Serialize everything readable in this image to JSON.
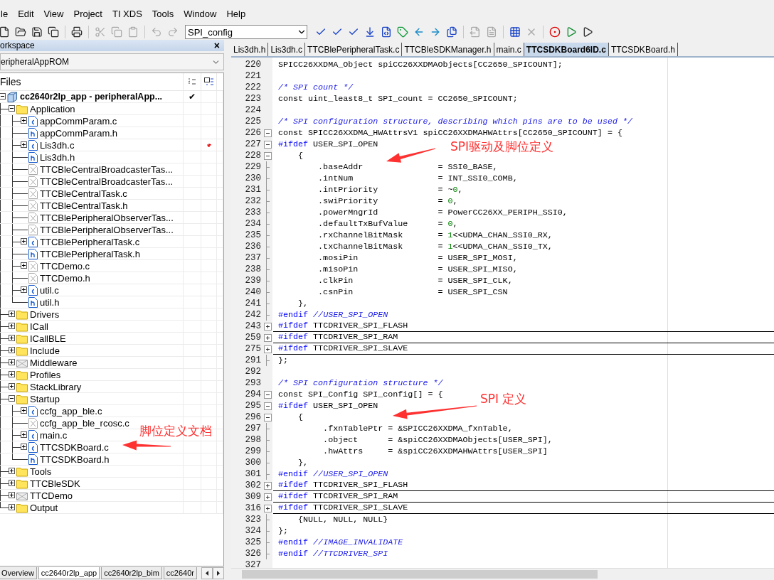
{
  "menu": [
    "le",
    "Edit",
    "View",
    "Project",
    "TI XDS",
    "Tools",
    "Window",
    "Help"
  ],
  "toolbar": {
    "buttons": [
      {
        "disabled": false
      },
      {
        "disabled": false
      },
      {
        "disabled": false
      },
      {
        "disabled": false
      },
      {
        "disabled": false
      },
      {
        "disabled": true
      },
      {
        "disabled": true
      },
      {
        "disabled": true
      },
      {
        "disabled": true
      },
      {
        "disabled": true
      }
    ],
    "combo": "SPI_config",
    "buttons_2": [
      {
        "disabled": false
      },
      {
        "disabled": false
      },
      {
        "disabled": false
      },
      {
        "disabled": false
      },
      {
        "disabled": false
      },
      {
        "disabled": false
      },
      {
        "disabled": false
      },
      {
        "disabled": false
      },
      {
        "disabled": false
      },
      {
        "disabled": true
      },
      {
        "disabled": true
      },
      {
        "disabled": false
      },
      {
        "disabled": true
      },
      {
        "disabled": false
      },
      {
        "disabled": false
      },
      {
        "disabled": false
      }
    ]
  },
  "workspace": {
    "title": "orkspace",
    "close": "×",
    "configuration": "eripheralAppROM",
    "tree": {
      "header": "Files",
      "root": {
        "label": "cc2640r2lp_app - peripheralApp...",
        "kind": "project",
        "expanded": true,
        "check": "✔",
        "children": [
          {
            "label": "Application",
            "kind": "folder",
            "expanded": true,
            "children": [
              {
                "label": "appCommParam.c",
                "kind": "c",
                "expanded": false
              },
              {
                "label": "appCommParam.h",
                "kind": "h"
              },
              {
                "label": "Lis3dh.c",
                "kind": "c",
                "expanded": false,
                "modified": true
              },
              {
                "label": "Lis3dh.h",
                "kind": "h"
              },
              {
                "label": "TTCBleCentralBroadcasterTas...",
                "kind": "excluded"
              },
              {
                "label": "TTCBleCentralBroadcasterTas...",
                "kind": "excluded"
              },
              {
                "label": "TTCBleCentralTask.c",
                "kind": "excluded"
              },
              {
                "label": "TTCBleCentralTask.h",
                "kind": "excluded"
              },
              {
                "label": "TTCBlePeripheralObserverTas...",
                "kind": "excluded"
              },
              {
                "label": "TTCBlePeripheralObserverTas...",
                "kind": "excluded"
              },
              {
                "label": "TTCBlePeripheralTask.c",
                "kind": "c",
                "expanded": false
              },
              {
                "label": "TTCBlePeripheralTask.h",
                "kind": "h"
              },
              {
                "label": "TTCDemo.c",
                "kind": "excluded",
                "expanded": false
              },
              {
                "label": "TTCDemo.h",
                "kind": "excluded"
              },
              {
                "label": "util.c",
                "kind": "c",
                "expanded": false
              },
              {
                "label": "util.h",
                "kind": "h"
              }
            ]
          },
          {
            "label": "Drivers",
            "kind": "folder",
            "expanded": false
          },
          {
            "label": "ICall",
            "kind": "folder",
            "expanded": false
          },
          {
            "label": "ICallBLE",
            "kind": "folder",
            "expanded": false
          },
          {
            "label": "Include",
            "kind": "folder",
            "expanded": false
          },
          {
            "label": "Middleware",
            "kind": "folder-excluded",
            "expanded": false
          },
          {
            "label": "Profiles",
            "kind": "folder",
            "expanded": false
          },
          {
            "label": "StackLibrary",
            "kind": "folder",
            "expanded": false
          },
          {
            "label": "Startup",
            "kind": "folder",
            "expanded": true,
            "children": [
              {
                "label": "ccfg_app_ble.c",
                "kind": "c",
                "expanded": false
              },
              {
                "label": "ccfg_app_ble_rcosc.c",
                "kind": "excluded"
              },
              {
                "label": "main.c",
                "kind": "c",
                "expanded": false
              },
              {
                "label": "TTCSDKBoard.c",
                "kind": "c",
                "expanded": false
              },
              {
                "label": "TTCSDKBoard.h",
                "kind": "h"
              }
            ]
          },
          {
            "label": "Tools",
            "kind": "folder",
            "expanded": false
          },
          {
            "label": "TTCBleSDK",
            "kind": "folder",
            "expanded": false
          },
          {
            "label": "TTCDemo",
            "kind": "folder-excluded",
            "expanded": false
          },
          {
            "label": "Output",
            "kind": "folder",
            "expanded": false
          }
        ]
      }
    },
    "tabs": [
      {
        "label": "Overview",
        "selected": false
      },
      {
        "label": "cc2640r2lp_app",
        "selected": true
      },
      {
        "label": "cc2640r2lp_bim",
        "selected": false
      },
      {
        "label": "cc2640r",
        "selected": false
      }
    ]
  },
  "editor": {
    "tabs": [
      {
        "label": "Lis3dh.h",
        "selected": false
      },
      {
        "label": "Lis3dh.c",
        "selected": false
      },
      {
        "label": "TTCBlePeripheralTask.c",
        "selected": false
      },
      {
        "label": "TTCBleSDKManager.h",
        "selected": false
      },
      {
        "label": "main.c",
        "selected": false
      },
      {
        "label": "TTCSDKBoard6ID.c",
        "selected": true
      },
      {
        "label": "TTCSDKBoard.h",
        "selected": false
      }
    ],
    "lines": [
      {
        "number": "220",
        "kind": "plain",
        "code": [
          {
            "kind": "text",
            "text": "SPICC26XXDMA_Object spiCC26XXDMAObjects[CC2650_SPICOUNT];"
          }
        ]
      },
      {
        "number": "221",
        "kind": "plain"
      },
      {
        "number": "222",
        "kind": "plain",
        "code": [
          {
            "kind": "comment",
            "text": "/* SPI count */"
          }
        ]
      },
      {
        "number": "223",
        "kind": "plain",
        "code": [
          {
            "kind": "text",
            "text": "const uint_least8_t SPI_count = CC2650_SPICOUNT;"
          }
        ]
      },
      {
        "number": "224",
        "kind": "plain"
      },
      {
        "number": "225",
        "kind": "plain",
        "code": [
          {
            "kind": "comment",
            "text": "/* SPI configuration structure, describing which pins are to be used */"
          }
        ]
      },
      {
        "number": "226",
        "kind": "fold-start",
        "code": [
          {
            "kind": "text",
            "text": "const SPICC26XXDMA_HWAttrsV1 spiCC26XXDMAHWAttrs[CC2650_SPICOUNT] = {"
          }
        ]
      },
      {
        "number": "227",
        "kind": "fold-start",
        "code": [
          {
            "kind": "directive",
            "text": "#ifdef"
          },
          {
            "kind": "text",
            "text": " USER_SPI_OPEN"
          }
        ]
      },
      {
        "number": "228",
        "kind": "fold-start",
        "code": [
          {
            "kind": "text",
            "text": "    {"
          }
        ]
      },
      {
        "number": "229",
        "kind": "fold-body",
        "code": [
          {
            "kind": "text",
            "text": "        .baseAddr               = SSI0_BASE,"
          }
        ]
      },
      {
        "number": "230",
        "kind": "fold-body",
        "code": [
          {
            "kind": "text",
            "text": "        .intNum                 = INT_SSI0_COMB,"
          }
        ]
      },
      {
        "number": "231",
        "kind": "fold-body",
        "code": [
          {
            "kind": "text",
            "text": "        .intPriority            = ~"
          },
          {
            "kind": "number",
            "text": "0"
          },
          {
            "kind": "text",
            "text": ","
          }
        ]
      },
      {
        "number": "232",
        "kind": "fold-body",
        "code": [
          {
            "kind": "text",
            "text": "        .swiPriority            = "
          },
          {
            "kind": "number",
            "text": "0"
          },
          {
            "kind": "text",
            "text": ","
          }
        ]
      },
      {
        "number": "233",
        "kind": "fold-body",
        "code": [
          {
            "kind": "text",
            "text": "        .powerMngrId            = PowerCC26XX_PERIPH_SSI0,"
          }
        ]
      },
      {
        "number": "234",
        "kind": "fold-body",
        "code": [
          {
            "kind": "text",
            "text": "        .defaultTxBufValue      = "
          },
          {
            "kind": "number",
            "text": "0"
          },
          {
            "kind": "text",
            "text": ","
          }
        ]
      },
      {
        "number": "235",
        "kind": "fold-body",
        "code": [
          {
            "kind": "text",
            "text": "        .rxChannelBitMask       = "
          },
          {
            "kind": "number",
            "text": "1"
          },
          {
            "kind": "text",
            "text": "<<UDMA_CHAN_SSI0_RX,"
          }
        ]
      },
      {
        "number": "236",
        "kind": "fold-body",
        "code": [
          {
            "kind": "text",
            "text": "        .txChannelBitMask       = "
          },
          {
            "kind": "number",
            "text": "1"
          },
          {
            "kind": "text",
            "text": "<<UDMA_CHAN_SSI0_TX,"
          }
        ]
      },
      {
        "number": "237",
        "kind": "fold-body",
        "code": [
          {
            "kind": "text",
            "text": "        .mosiPin                = USER_SPI_MOSI,"
          }
        ]
      },
      {
        "number": "238",
        "kind": "fold-body",
        "code": [
          {
            "kind": "text",
            "text": "        .misoPin                = USER_SPI_MISO,"
          }
        ]
      },
      {
        "number": "239",
        "kind": "fold-body",
        "code": [
          {
            "kind": "text",
            "text": "        .clkPin                 = USER_SPI_CLK,"
          }
        ]
      },
      {
        "number": "240",
        "kind": "fold-body",
        "code": [
          {
            "kind": "text",
            "text": "        .csnPin                 = USER_SPI_CSN"
          }
        ]
      },
      {
        "number": "241",
        "kind": "fold-body",
        "code": [
          {
            "kind": "text",
            "text": "    },"
          }
        ]
      },
      {
        "number": "242",
        "kind": "fold-body",
        "code": [
          {
            "kind": "directive",
            "text": "#endif"
          },
          {
            "kind": "comment",
            "text": " //USER_SPI_OPEN"
          }
        ]
      },
      {
        "number": "243",
        "kind": "folded",
        "code": [
          {
            "kind": "directive",
            "text": "#ifdef"
          },
          {
            "kind": "text",
            "text": " TTCDRIVER_SPI_FLASH"
          }
        ]
      },
      {
        "number": "259",
        "kind": "folded",
        "code": [
          {
            "kind": "directive",
            "text": "#ifdef"
          },
          {
            "kind": "text",
            "text": " TTCDRIVER_SPI_RAM"
          }
        ]
      },
      {
        "number": "275",
        "kind": "folded",
        "code": [
          {
            "kind": "directive",
            "text": "#ifdef"
          },
          {
            "kind": "text",
            "text": " TTCDRIVER_SPI_SLAVE"
          }
        ]
      },
      {
        "number": "291",
        "kind": "fold-body",
        "code": [
          {
            "kind": "text",
            "text": "};"
          }
        ]
      },
      {
        "number": "292",
        "kind": "plain"
      },
      {
        "number": "293",
        "kind": "plain",
        "code": [
          {
            "kind": "comment",
            "text": "/* SPI configuration structure */"
          }
        ]
      },
      {
        "number": "294",
        "kind": "fold-start",
        "code": [
          {
            "kind": "text",
            "text": "const SPI_Config SPI_config[] = {"
          }
        ]
      },
      {
        "number": "295",
        "kind": "fold-start",
        "code": [
          {
            "kind": "directive",
            "text": "#ifdef"
          },
          {
            "kind": "text",
            "text": " USER_SPI_OPEN"
          }
        ]
      },
      {
        "number": "296",
        "kind": "fold-start",
        "code": [
          {
            "kind": "text",
            "text": "    {"
          }
        ]
      },
      {
        "number": "297",
        "kind": "fold-body",
        "code": [
          {
            "kind": "text",
            "text": "         .fxnTablePtr = &SPICC26XXDMA_fxnTable,"
          }
        ]
      },
      {
        "number": "298",
        "kind": "fold-body",
        "code": [
          {
            "kind": "text",
            "text": "         .object      = &spiCC26XXDMAObjects[USER_SPI],"
          }
        ]
      },
      {
        "number": "299",
        "kind": "fold-body",
        "code": [
          {
            "kind": "text",
            "text": "         .hwAttrs     = &spiCC26XXDMAHWAttrs[USER_SPI]"
          }
        ]
      },
      {
        "number": "300",
        "kind": "fold-body",
        "code": [
          {
            "kind": "text",
            "text": "    },"
          }
        ]
      },
      {
        "number": "301",
        "kind": "fold-body",
        "code": [
          {
            "kind": "directive",
            "text": "#endif"
          },
          {
            "kind": "comment",
            "text": " //USER_SPI_OPEN"
          }
        ]
      },
      {
        "number": "302",
        "kind": "folded",
        "code": [
          {
            "kind": "directive",
            "text": "#ifdef"
          },
          {
            "kind": "text",
            "text": " TTCDRIVER_SPI_FLASH"
          }
        ]
      },
      {
        "number": "309",
        "kind": "folded",
        "code": [
          {
            "kind": "directive",
            "text": "#ifdef"
          },
          {
            "kind": "text",
            "text": " TTCDRIVER_SPI_RAM"
          }
        ]
      },
      {
        "number": "316",
        "kind": "folded",
        "code": [
          {
            "kind": "directive",
            "text": "#ifdef"
          },
          {
            "kind": "text",
            "text": " TTCDRIVER_SPI_SLAVE"
          }
        ]
      },
      {
        "number": "323",
        "kind": "fold-body",
        "code": [
          {
            "kind": "text",
            "text": "    {NULL, NULL, NULL}"
          }
        ]
      },
      {
        "number": "324",
        "kind": "fold-body",
        "code": [
          {
            "kind": "text",
            "text": "};"
          }
        ]
      },
      {
        "number": "325",
        "kind": "fold-body",
        "code": [
          {
            "kind": "directive",
            "text": "#endif"
          },
          {
            "kind": "comment",
            "text": " //IMAGE_INVALIDATE"
          }
        ]
      },
      {
        "number": "326",
        "kind": "fold-body",
        "code": [
          {
            "kind": "directive",
            "text": "#endif"
          },
          {
            "kind": "comment",
            "text": " //TTCDRIVER_SPI"
          }
        ]
      },
      {
        "number": "327",
        "kind": "plain"
      }
    ]
  },
  "annotations": [
    {
      "text": "SPI驱动及脚位定义"
    },
    {
      "text": "SPI 定义"
    },
    {
      "text": "脚位定义文档"
    }
  ]
}
